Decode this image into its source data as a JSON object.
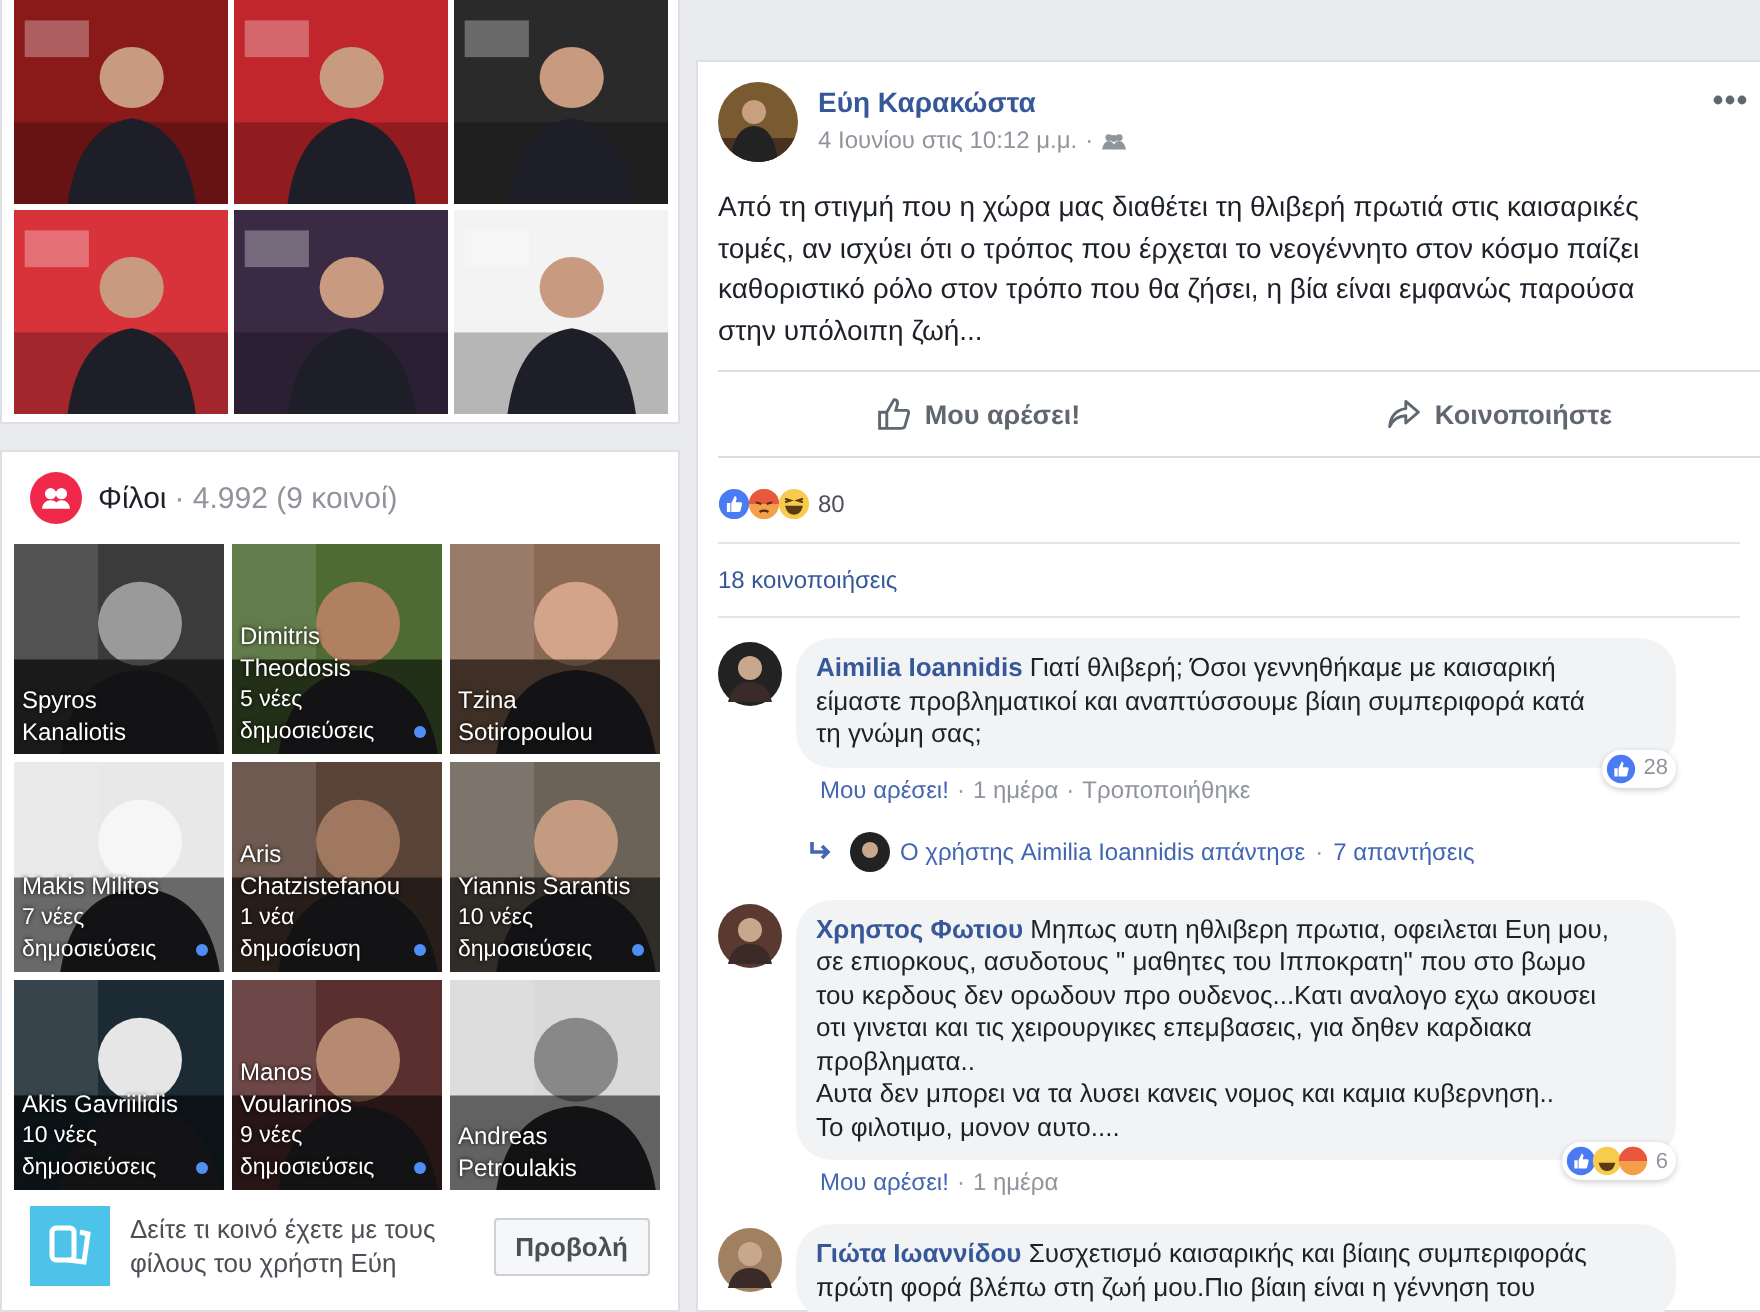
{
  "friends": {
    "title": "Φίλοι",
    "count": "· 4.992 (9 κοινοί)",
    "tiles": [
      {
        "name": "Spyros Kanaliotis"
      },
      {
        "name": "Dimitris Theodosis",
        "posts": "5 νέες δημοσιεύσεις"
      },
      {
        "name": "Tzina Sotiropoulou"
      },
      {
        "name": "Makis Militos",
        "posts": "7 νέες δημοσιεύσεις"
      },
      {
        "name": "Aris Chatzistefanou",
        "posts": "1 νέα δημοσίευση"
      },
      {
        "name": "Yiannis Sarantis",
        "posts": "10 νέες δημοσιεύσεις"
      },
      {
        "name": "Akis Gavriilidis",
        "posts": "10 νέες δημοσιεύσεις"
      },
      {
        "name": "Manos Voularinos",
        "posts": "9 νέες δημοσιεύσεις"
      },
      {
        "name": "Andreas Petroulakis"
      }
    ],
    "mutual": {
      "text": "Δείτε τι κοινό έχετε με τους φίλους του χρήστη Εύη",
      "button": "Προβολή"
    }
  },
  "post": {
    "author": "Εύη Καρακώστα",
    "time": "4 Ιουνίου στις 10:12 μ.μ.",
    "separator": "·",
    "body": "Από τη στιγμή που η χώρα μας διαθέτει τη θλιβερή πρωτιά στις καισαρικές τομές, αν ισχύει ότι ο τρόπος που έρχεται το νεογέννητο στον κόσμο παίζει καθοριστικό ρόλο στον τρόπο που θα ζήσει, η βία είναι εμφανώς παρούσα στην υπόλοιπη ζωή...",
    "actions": [
      {
        "kind": "like",
        "label": "Μου αρέσει!"
      },
      {
        "kind": "share",
        "label": "Κοινοποιήστε"
      }
    ],
    "reactions": [
      {
        "kind": "like"
      },
      {
        "kind": "angry"
      },
      {
        "kind": "haha"
      }
    ],
    "reaction_count": "80",
    "shares": "18 κοινοποιήσεις"
  },
  "meta_separator": "·",
  "comments": [
    {
      "author": "Aimilia Ioannidis",
      "text": "Γιατί θλιβερή; Όσοι γεννηθήκαμε με καισαρική είμαστε προβληματικοί και αναπτύσσουμε βίαιη συμπεριφορά κατά τη γνώμη σας;",
      "meta": [
        "Μου αρέσει!",
        "1 ημέρα",
        "Τροποποιήθηκε"
      ],
      "reactions": [
        {
          "kind": "like"
        }
      ],
      "reaction_count": "28",
      "replies": {
        "text": "Ο χρήστης Aimilia Ioannidis απάντησε",
        "count": "7 απαντήσεις"
      }
    },
    {
      "author": "Χρηστος Φωτιου",
      "text": "Μηπως αυτη ηθλιβερη πρωτια, οφειλεται Ευη μου, σε επιορκους, ασυδοτους \" μαθητες του Ιπποκρατη\" που στο βωμο του κερδους δεν ορωδουν προ ουδενος...Κατι αναλογο εχω ακουσει οτι γινεται και τις χειρουργικες επεμβασεις, για δηθεν καρδιακα προβληματα..\nΑυτα δεν μπορει να τα λυσει κανεις νομος και καμια κυβερνηση..\nΤο φιλοτιμο, μονον αυτο....",
      "meta": [
        "Μου αρέσει!",
        "1 ημέρα"
      ],
      "reactions": [
        {
          "kind": "like"
        },
        {
          "kind": "haha"
        },
        {
          "kind": "angry"
        }
      ],
      "reaction_count": "6"
    },
    {
      "author": "Γιώτα Ιωαννίδου",
      "text": "Συσχετισμό καισαρικής και βίαιης συμπεριφοράς πρώτη φορά βλέπω στη ζωή μου.Πιο βίαιη είναι η γέννηση του"
    }
  ]
}
